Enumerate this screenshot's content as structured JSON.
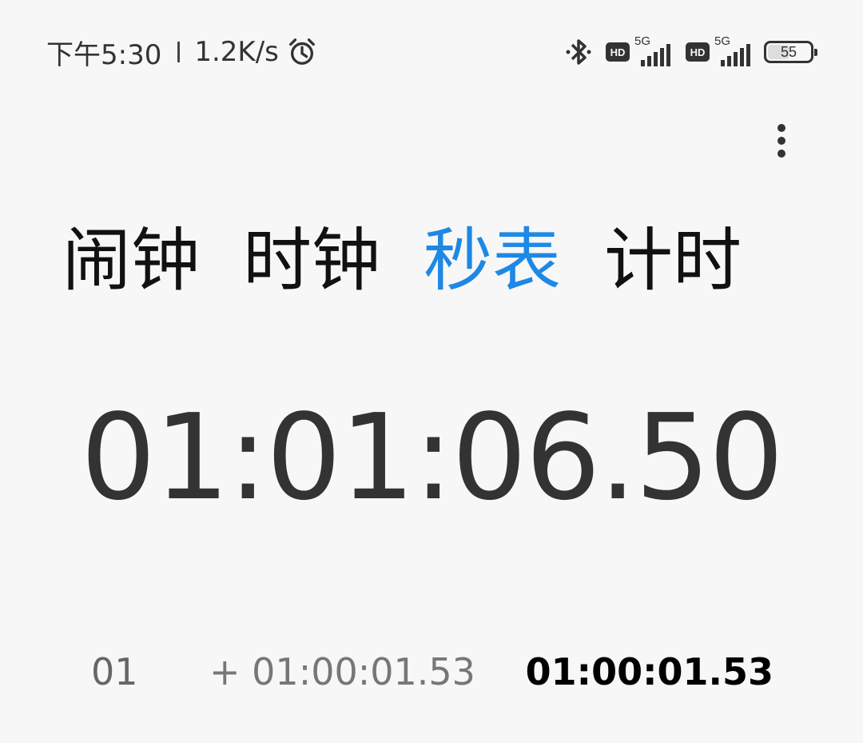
{
  "status_bar": {
    "time": "下午5:30",
    "net_speed": "1.2K/s",
    "icons": [
      "alarm-icon",
      "bluetooth-icon",
      "hd-icon",
      "signal-icon",
      "battery-icon"
    ],
    "sim1": {
      "hd": "HD",
      "network": "5G"
    },
    "sim2": {
      "hd": "HD",
      "network": "5G"
    },
    "battery_level": "55"
  },
  "tabs": [
    {
      "label": "闹钟",
      "active": false
    },
    {
      "label": "时钟",
      "active": false
    },
    {
      "label": "秒表",
      "active": true
    },
    {
      "label": "计时",
      "active": false
    }
  ],
  "stopwatch": {
    "elapsed": "01:01:06.50"
  },
  "laps": [
    {
      "index": "01",
      "diff": "+ 01:00:01.53",
      "total": "01:00:01.53"
    }
  ],
  "colors": {
    "accent": "#1e88e5",
    "background": "#f7f7f7",
    "text": "#333333"
  }
}
